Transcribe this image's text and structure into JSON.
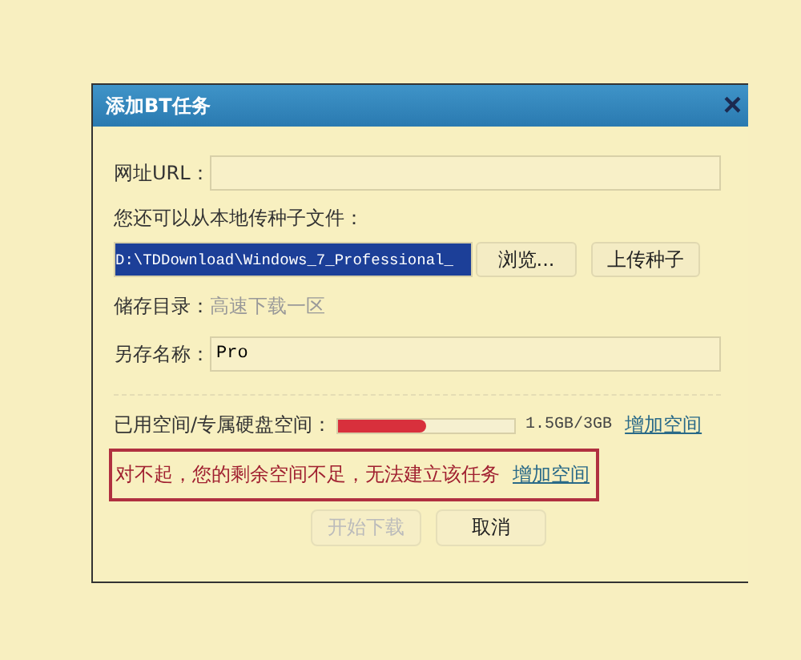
{
  "window": {
    "title": "添加BT任务",
    "close": "×"
  },
  "url": {
    "label": "网址URL："
  },
  "local_hint": "您还可以从本地传种子文件：",
  "torrent": {
    "path": "D:\\TDDownload\\Windows_7_Professional_",
    "selected": true,
    "browse": "浏览...",
    "upload": "上传种子"
  },
  "storage": {
    "label": "储存目录：",
    "value": "高速下载一区"
  },
  "save_name": {
    "label": "另存名称：",
    "value": "Pro"
  },
  "space": {
    "label": "已用空间/专属硬盘空间：",
    "level": 0.5,
    "reading": "1.5GB/3GB",
    "link": "增加空间"
  },
  "error": {
    "message": "对不起，您的剩余空间不足，无法建立该任务",
    "link": "增加空间"
  },
  "buttons": [
    {
      "label": "开始下载",
      "disabled": true
    },
    {
      "label": "取消",
      "disabled": false
    }
  ]
}
